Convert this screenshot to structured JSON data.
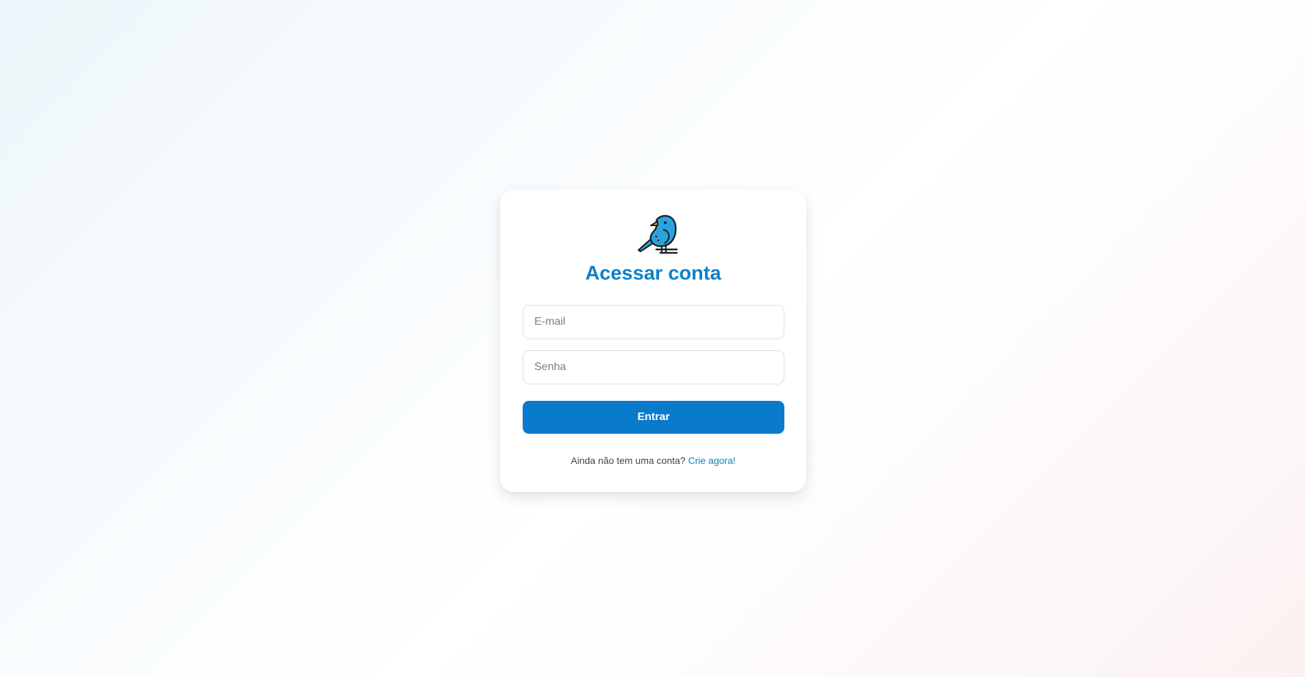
{
  "login": {
    "logo": "bird-logo-icon",
    "title": "Acessar conta",
    "email_placeholder": "E-mail",
    "password_placeholder": "Senha",
    "submit_label": "Entrar",
    "signup_prompt": "Ainda não tem uma conta?",
    "signup_link": "Crie agora!"
  },
  "colors": {
    "accent": "#0a82c9",
    "button": "#0a7acc",
    "bird_body": "#2ba3dd",
    "outline": "#1b1f23"
  }
}
